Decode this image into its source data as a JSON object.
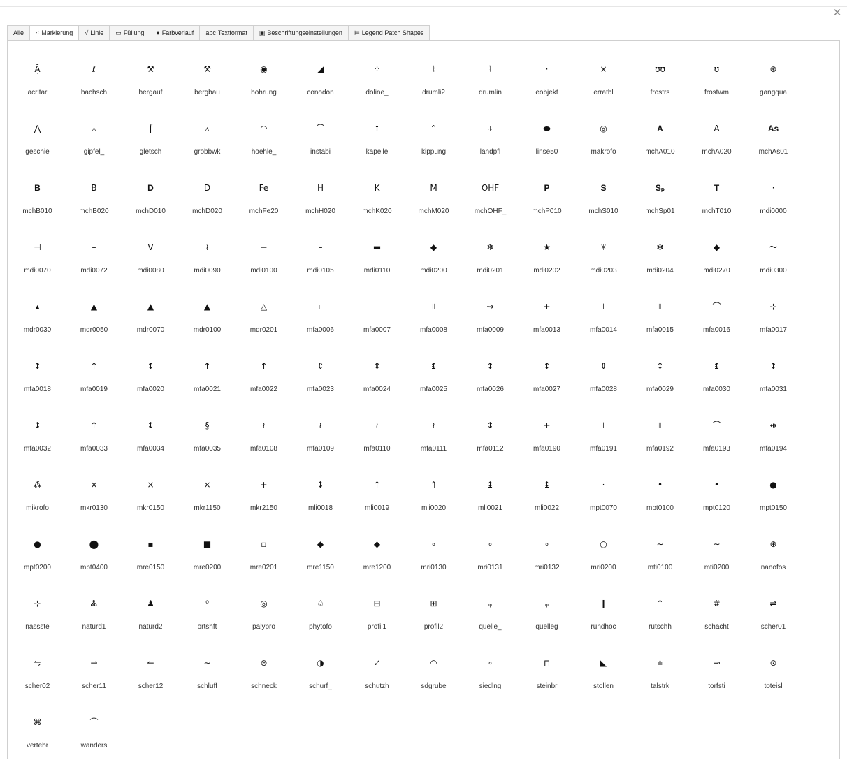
{
  "window": {
    "close_glyph": "✕"
  },
  "tabs": [
    {
      "label": "Alle",
      "icon": "",
      "icon_name": "",
      "active": false
    },
    {
      "label": "Markierung",
      "icon": "⁖",
      "icon_name": "marker-icon",
      "active": true
    },
    {
      "label": "Linie",
      "icon": "√",
      "icon_name": "line-icon",
      "active": false
    },
    {
      "label": "Füllung",
      "icon": "▭",
      "icon_name": "fill-icon",
      "active": false
    },
    {
      "label": "Farbverlauf",
      "icon": "●",
      "icon_name": "gradient-icon",
      "active": false
    },
    {
      "label": "Textformat",
      "icon": "abc",
      "icon_name": "text-format-icon",
      "active": false
    },
    {
      "label": "Beschriftungseinstellungen",
      "icon": "▣",
      "icon_name": "label-settings-icon",
      "active": false
    },
    {
      "label": "Legend Patch Shapes",
      "icon": "⊨",
      "icon_name": "legend-patch-icon",
      "active": false
    }
  ],
  "symbols": [
    {
      "name": "acritar",
      "glyph": "Ặ"
    },
    {
      "name": "bachsch",
      "glyph": "ℓ"
    },
    {
      "name": "bergauf",
      "glyph": "⚒"
    },
    {
      "name": "bergbau",
      "glyph": "⚒"
    },
    {
      "name": "bohrung",
      "glyph": "◉"
    },
    {
      "name": "conodon",
      "glyph": "◢"
    },
    {
      "name": "doline_",
      "glyph": "⁘"
    },
    {
      "name": "drumli2",
      "glyph": "⦚"
    },
    {
      "name": "drumlin",
      "glyph": "⦚"
    },
    {
      "name": "eobjekt",
      "glyph": "·"
    },
    {
      "name": "erratbl",
      "glyph": "×"
    },
    {
      "name": "frostrs",
      "glyph": "ʊʊ"
    },
    {
      "name": "frostwm",
      "glyph": "ʊ"
    },
    {
      "name": "gangqua",
      "glyph": "⊛"
    },
    {
      "name": "geschie",
      "glyph": "⋀"
    },
    {
      "name": "gipfel_",
      "glyph": "▵"
    },
    {
      "name": "gletsch",
      "glyph": "⌠"
    },
    {
      "name": "grobbwk",
      "glyph": "▵"
    },
    {
      "name": "hoehle_",
      "glyph": "◠"
    },
    {
      "name": "instabi",
      "glyph": "⌒"
    },
    {
      "name": "kapelle",
      "glyph": "ᵻ"
    },
    {
      "name": "kippung",
      "glyph": "⌃"
    },
    {
      "name": "landpfl",
      "glyph": "⍭"
    },
    {
      "name": "linse50",
      "glyph": "⬬"
    },
    {
      "name": "makrofo",
      "glyph": "◎"
    },
    {
      "name": "mchA010",
      "glyph": "A",
      "text": true
    },
    {
      "name": "mchA020",
      "glyph": "A"
    },
    {
      "name": "mchAs01",
      "glyph": "As",
      "text": true
    },
    {
      "name": "mchB010",
      "glyph": "B",
      "text": true
    },
    {
      "name": "mchB020",
      "glyph": "B"
    },
    {
      "name": "mchD010",
      "glyph": "D",
      "text": true
    },
    {
      "name": "mchD020",
      "glyph": "D"
    },
    {
      "name": "mchFe20",
      "glyph": "Fe"
    },
    {
      "name": "mchH020",
      "glyph": "H"
    },
    {
      "name": "mchK020",
      "glyph": "K"
    },
    {
      "name": "mchM020",
      "glyph": "M"
    },
    {
      "name": "mchOHF_",
      "glyph": "OHF"
    },
    {
      "name": "mchP010",
      "glyph": "P",
      "text": true
    },
    {
      "name": "mchS010",
      "glyph": "S",
      "text": true
    },
    {
      "name": "mchSp01",
      "glyph": "Sₚ",
      "text": true
    },
    {
      "name": "mchT010",
      "glyph": "T",
      "text": true
    },
    {
      "name": "mdi0000",
      "glyph": "·"
    },
    {
      "name": "mdi0070",
      "glyph": "⊣"
    },
    {
      "name": "mdi0072",
      "glyph": "–"
    },
    {
      "name": "mdi0080",
      "glyph": "V"
    },
    {
      "name": "mdi0090",
      "glyph": "≀"
    },
    {
      "name": "mdi0100",
      "glyph": "−"
    },
    {
      "name": "mdi0105",
      "glyph": "–"
    },
    {
      "name": "mdi0110",
      "glyph": "▬"
    },
    {
      "name": "mdi0200",
      "glyph": "◆"
    },
    {
      "name": "mdi0201",
      "glyph": "❄"
    },
    {
      "name": "mdi0202",
      "glyph": "★"
    },
    {
      "name": "mdi0203",
      "glyph": "✳"
    },
    {
      "name": "mdi0204",
      "glyph": "✻"
    },
    {
      "name": "mdi0270",
      "glyph": "◆"
    },
    {
      "name": "mdi0300",
      "glyph": "〜"
    },
    {
      "name": "mdr0030",
      "glyph": "▴"
    },
    {
      "name": "mdr0050",
      "glyph": "▲"
    },
    {
      "name": "mdr0070",
      "glyph": "▲"
    },
    {
      "name": "mdr0100",
      "glyph": "▲"
    },
    {
      "name": "mdr0201",
      "glyph": "△"
    },
    {
      "name": "mfa0006",
      "glyph": "ⱶ"
    },
    {
      "name": "mfa0007",
      "glyph": "⊥"
    },
    {
      "name": "mfa0008",
      "glyph": "⫫"
    },
    {
      "name": "mfa0009",
      "glyph": "⇝"
    },
    {
      "name": "mfa0013",
      "glyph": "+"
    },
    {
      "name": "mfa0014",
      "glyph": "⊥"
    },
    {
      "name": "mfa0015",
      "glyph": "⫫"
    },
    {
      "name": "mfa0016",
      "glyph": "⌒"
    },
    {
      "name": "mfa0017",
      "glyph": "⊹"
    },
    {
      "name": "mfa0018",
      "glyph": "↕"
    },
    {
      "name": "mfa0019",
      "glyph": "↑"
    },
    {
      "name": "mfa0020",
      "glyph": "↕"
    },
    {
      "name": "mfa0021",
      "glyph": "↑"
    },
    {
      "name": "mfa0022",
      "glyph": "↑"
    },
    {
      "name": "mfa0023",
      "glyph": "⇕"
    },
    {
      "name": "mfa0024",
      "glyph": "⇕"
    },
    {
      "name": "mfa0025",
      "glyph": "↨"
    },
    {
      "name": "mfa0026",
      "glyph": "↕"
    },
    {
      "name": "mfa0027",
      "glyph": "↕"
    },
    {
      "name": "mfa0028",
      "glyph": "⇕"
    },
    {
      "name": "mfa0029",
      "glyph": "↕"
    },
    {
      "name": "mfa0030",
      "glyph": "↨"
    },
    {
      "name": "mfa0031",
      "glyph": "↕"
    },
    {
      "name": "mfa0032",
      "glyph": "↕"
    },
    {
      "name": "mfa0033",
      "glyph": "↑"
    },
    {
      "name": "mfa0034",
      "glyph": "↕"
    },
    {
      "name": "mfa0035",
      "glyph": "§"
    },
    {
      "name": "mfa0108",
      "glyph": "≀"
    },
    {
      "name": "mfa0109",
      "glyph": "≀"
    },
    {
      "name": "mfa0110",
      "glyph": "≀"
    },
    {
      "name": "mfa0111",
      "glyph": "≀"
    },
    {
      "name": "mfa0112",
      "glyph": "↕"
    },
    {
      "name": "mfa0190",
      "glyph": "+"
    },
    {
      "name": "mfa0191",
      "glyph": "⊥"
    },
    {
      "name": "mfa0192",
      "glyph": "⫫"
    },
    {
      "name": "mfa0193",
      "glyph": "⌒"
    },
    {
      "name": "mfa0194",
      "glyph": "⇹"
    },
    {
      "name": "mikrofo",
      "glyph": "⁂"
    },
    {
      "name": "mkr0130",
      "glyph": "×"
    },
    {
      "name": "mkr0150",
      "glyph": "×"
    },
    {
      "name": "mkr1150",
      "glyph": "×"
    },
    {
      "name": "mkr2150",
      "glyph": "+"
    },
    {
      "name": "mli0018",
      "glyph": "↕"
    },
    {
      "name": "mli0019",
      "glyph": "↑"
    },
    {
      "name": "mli0020",
      "glyph": "⇑"
    },
    {
      "name": "mli0021",
      "glyph": "↨"
    },
    {
      "name": "mli0022",
      "glyph": "↨"
    },
    {
      "name": "mpt0070",
      "glyph": "·"
    },
    {
      "name": "mpt0100",
      "glyph": "•"
    },
    {
      "name": "mpt0120",
      "glyph": "•"
    },
    {
      "name": "mpt0150",
      "glyph": "●"
    },
    {
      "name": "mpt0200",
      "glyph": "●"
    },
    {
      "name": "mpt0400",
      "glyph": "⬤"
    },
    {
      "name": "mre0150",
      "glyph": "▪"
    },
    {
      "name": "mre0200",
      "glyph": "■"
    },
    {
      "name": "mre0201",
      "glyph": "▫"
    },
    {
      "name": "mre1150",
      "glyph": "◆"
    },
    {
      "name": "mre1200",
      "glyph": "◆"
    },
    {
      "name": "mri0130",
      "glyph": "∘"
    },
    {
      "name": "mri0131",
      "glyph": "∘"
    },
    {
      "name": "mri0132",
      "glyph": "∘"
    },
    {
      "name": "mri0200",
      "glyph": "○"
    },
    {
      "name": "mti0100",
      "glyph": "∼"
    },
    {
      "name": "mti0200",
      "glyph": "∼"
    },
    {
      "name": "nanofos",
      "glyph": "⊕"
    },
    {
      "name": "nassste",
      "glyph": "⊹"
    },
    {
      "name": "naturd1",
      "glyph": "Ꮬ"
    },
    {
      "name": "naturd2",
      "glyph": "♟"
    },
    {
      "name": "ortshft",
      "glyph": "⁰"
    },
    {
      "name": "palypro",
      "glyph": "◎"
    },
    {
      "name": "phytofo",
      "glyph": "♤"
    },
    {
      "name": "profil1",
      "glyph": "⊟"
    },
    {
      "name": "profil2",
      "glyph": "⊞"
    },
    {
      "name": "quelle_",
      "glyph": "ᵩ"
    },
    {
      "name": "quelleg",
      "glyph": "ᵩ"
    },
    {
      "name": "rundhoc",
      "glyph": "❙"
    },
    {
      "name": "rutschh",
      "glyph": "⌃"
    },
    {
      "name": "schacht",
      "glyph": "#"
    },
    {
      "name": "scher01",
      "glyph": "⇌"
    },
    {
      "name": "scher02",
      "glyph": "⇋"
    },
    {
      "name": "scher11",
      "glyph": "⇀"
    },
    {
      "name": "scher12",
      "glyph": "↼"
    },
    {
      "name": "schluff",
      "glyph": "∼"
    },
    {
      "name": "schneck",
      "glyph": "⊜"
    },
    {
      "name": "schurf_",
      "glyph": "◑"
    },
    {
      "name": "schutzh",
      "glyph": "✓"
    },
    {
      "name": "sdgrube",
      "glyph": "◠"
    },
    {
      "name": "siedlng",
      "glyph": "∘"
    },
    {
      "name": "steinbr",
      "glyph": "⊓"
    },
    {
      "name": "stollen",
      "glyph": "◣"
    },
    {
      "name": "talstrk",
      "glyph": "⩮"
    },
    {
      "name": "torfsti",
      "glyph": "⊸"
    },
    {
      "name": "toteisl",
      "glyph": "⊙"
    },
    {
      "name": "vertebr",
      "glyph": "⌘"
    },
    {
      "name": "wanders",
      "glyph": "⌒"
    }
  ]
}
